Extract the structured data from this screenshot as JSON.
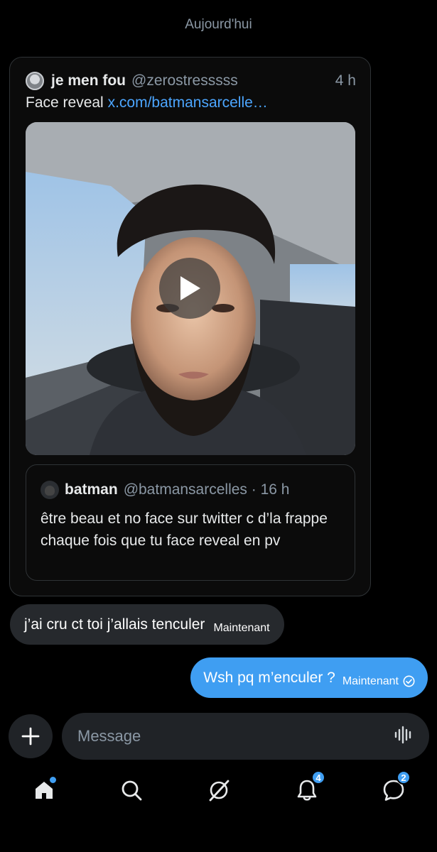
{
  "conversation": {
    "date_label": "Aujourd'hui"
  },
  "shared_tweet": {
    "author_name": "je men fou",
    "author_handle": "@zerostresssss",
    "time": "4 h",
    "text": "Face reveal",
    "link_text": "x.com/batmansarcelle…",
    "media": {
      "type": "video",
      "icon": "play-icon"
    },
    "quoted_tweet": {
      "author_name": "batman",
      "handle_time": "@batmansarcelles · 16 h",
      "text": "être beau et no face sur twitter c d’la frappe chaque fois que tu face reveal en pv"
    }
  },
  "messages": [
    {
      "direction": "incoming",
      "text": "j’ai cru ct toi j’allais tenculer",
      "timestamp": "Maintenant"
    },
    {
      "direction": "outgoing",
      "text": "Wsh pq m’enculer ?",
      "timestamp": "Maintenant",
      "status_icon": "read-check-icon"
    }
  ],
  "composer": {
    "placeholder": "Message",
    "add_icon": "plus-icon",
    "voice_icon": "waveform-icon"
  },
  "bottom_nav": {
    "home": {
      "icon": "home-icon",
      "has_dot": true
    },
    "search": {
      "icon": "search-icon"
    },
    "grok": {
      "icon": "grok-icon"
    },
    "notifications": {
      "icon": "bell-icon",
      "badge": "4"
    },
    "messages": {
      "icon": "chat-icon",
      "badge": "2"
    }
  },
  "colors": {
    "accent": "#3f9ef2",
    "background": "#000000",
    "bubble_incoming": "#26292d",
    "link": "#4ca6ff"
  }
}
